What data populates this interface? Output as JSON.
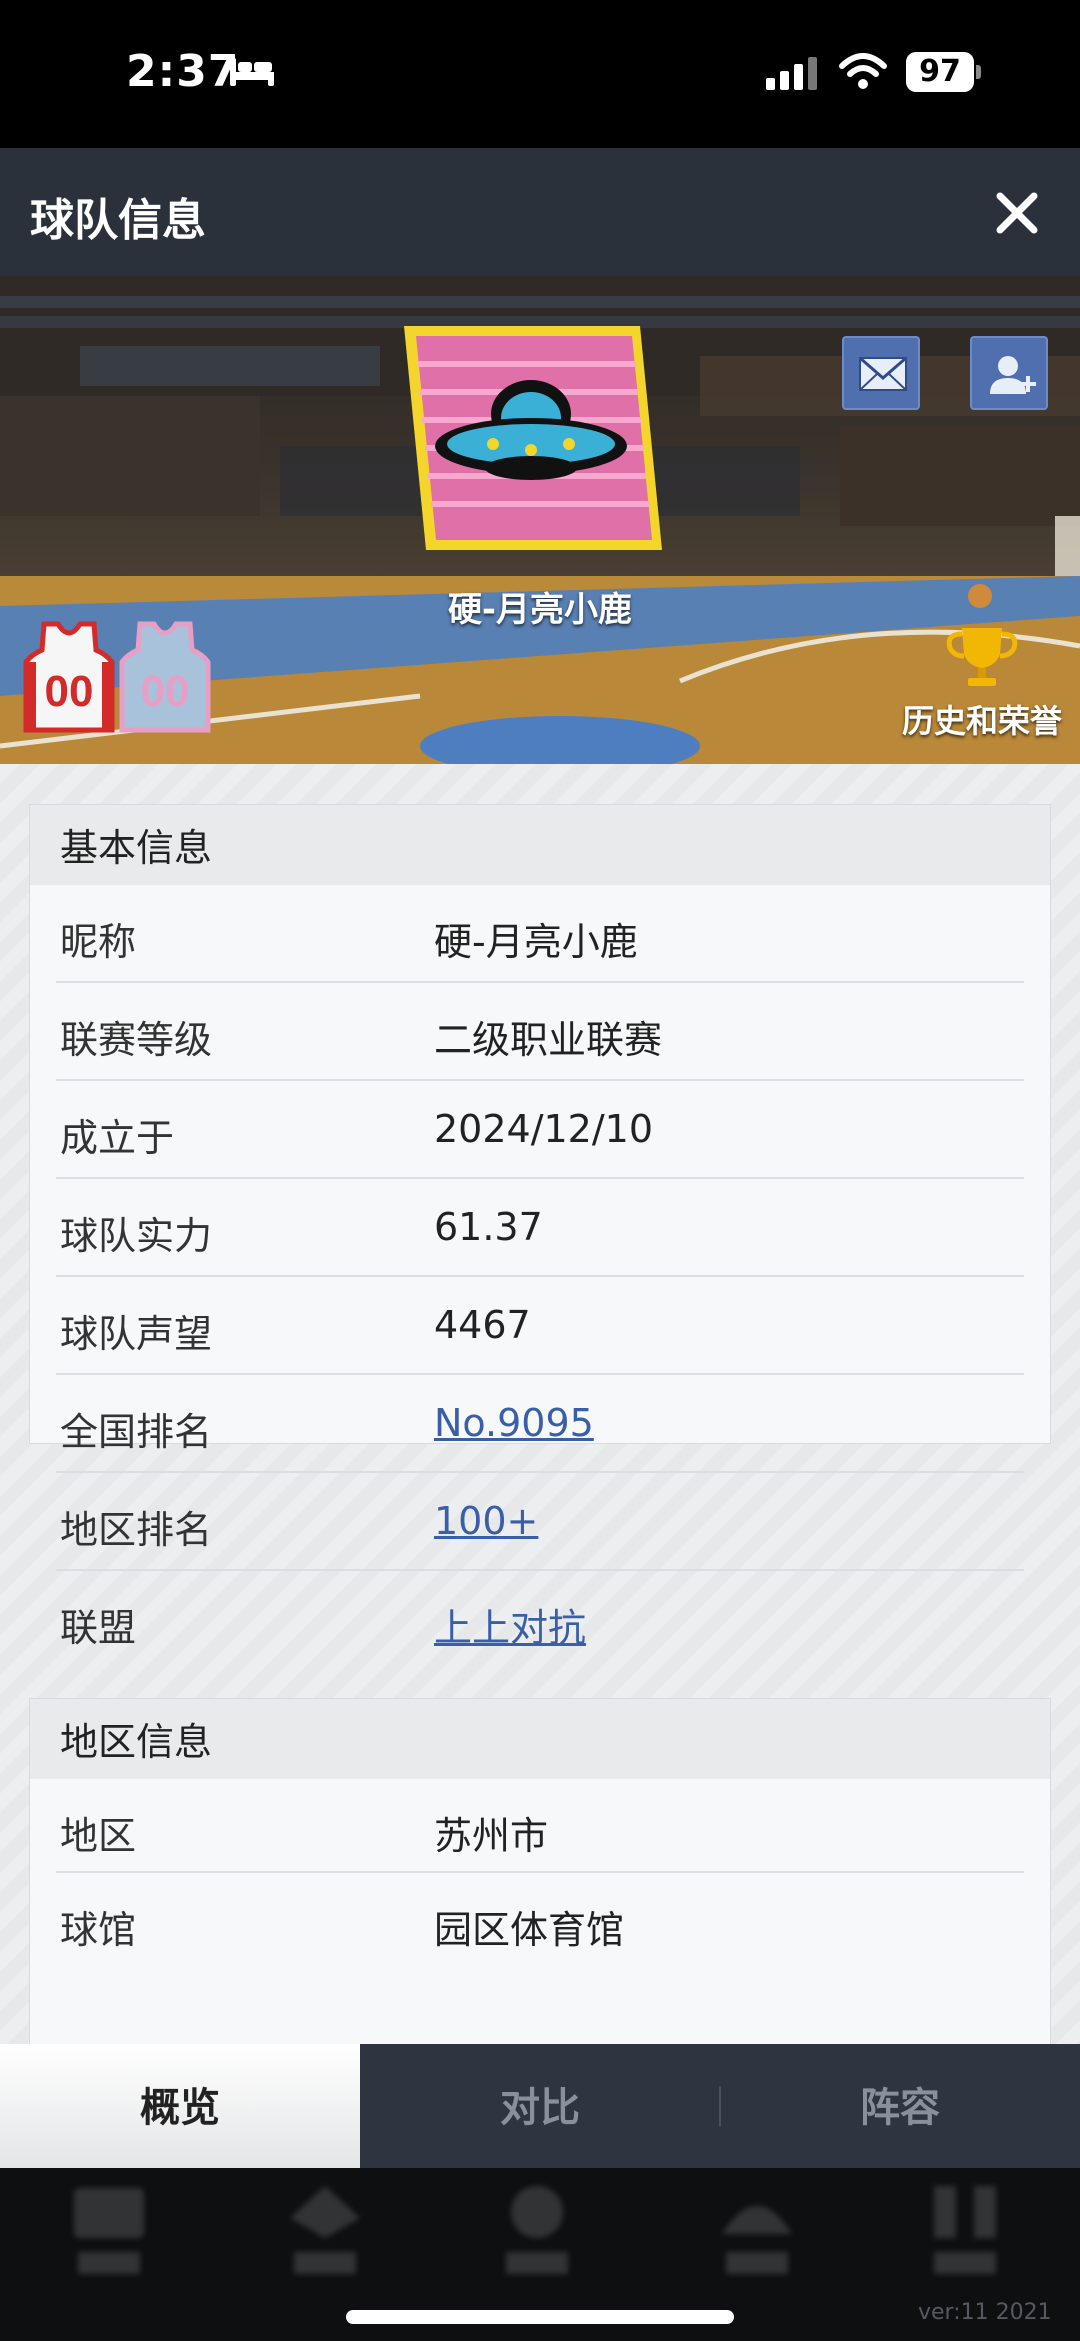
{
  "status_bar": {
    "time": "2:37",
    "battery": "97"
  },
  "header": {
    "title": "球队信息"
  },
  "team": {
    "name": "硬-月亮小鹿",
    "jersey_number": "00",
    "history_label": "历史和荣誉"
  },
  "basic_info": {
    "title": "基本信息",
    "rows": [
      {
        "label": "昵称",
        "value": "硬-月亮小鹿"
      },
      {
        "label": "联赛等级",
        "value": "二级职业联赛"
      },
      {
        "label": "成立于",
        "value": "2024/12/10"
      },
      {
        "label": "球队实力",
        "value": "61.37"
      },
      {
        "label": "球队声望",
        "value": "4467"
      },
      {
        "label": "全国排名",
        "value": "No.9095"
      },
      {
        "label": "地区排名",
        "value": "100+"
      },
      {
        "label": "联盟",
        "value": "上上对抗"
      }
    ]
  },
  "region_info": {
    "title": "地区信息",
    "rows": [
      {
        "label": "地区",
        "value": "苏州市"
      },
      {
        "label": "球馆",
        "value": "园区体育馆"
      }
    ]
  },
  "tabs": [
    {
      "label": "概览"
    },
    {
      "label": "对比"
    },
    {
      "label": "阵容"
    }
  ],
  "footer": {
    "version": "ver:11  2021"
  },
  "colors": {
    "header_bg": "#2b313b",
    "link": "#3a5ea8",
    "logo_pink": "#e070a8",
    "logo_yellow": "#f3d52c"
  }
}
